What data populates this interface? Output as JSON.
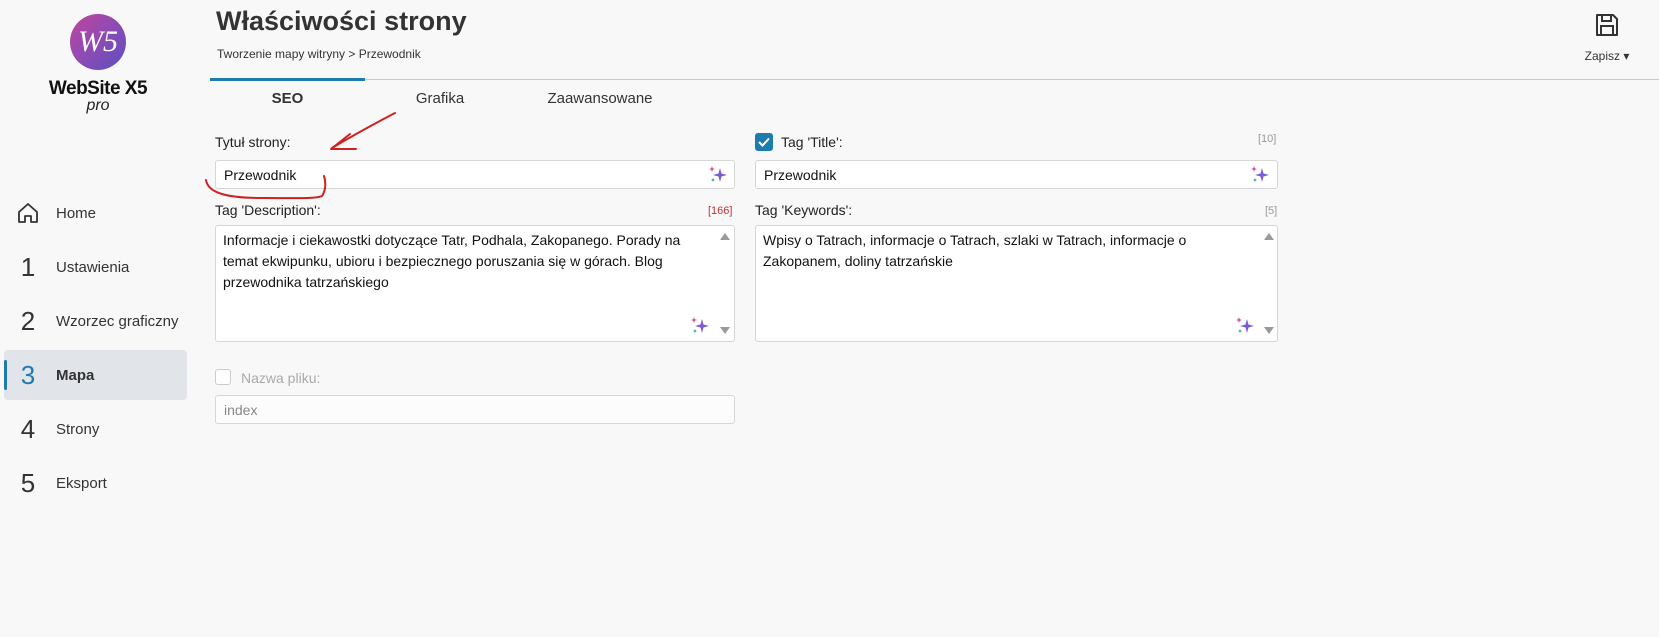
{
  "app": {
    "logo_monogram": "W5",
    "logo_name": "WebSite X5",
    "logo_edition": "pro"
  },
  "header": {
    "title": "Właściwości strony",
    "breadcrumb": "Tworzenie mapy witryny > Przewodnik",
    "save_label": "Zapisz ▾"
  },
  "sidebar": {
    "items": [
      {
        "num": "",
        "icon": "home-icon",
        "label": "Home",
        "active": false
      },
      {
        "num": "1",
        "label": "Ustawienia",
        "active": false
      },
      {
        "num": "2",
        "label": "Wzorzec graficzny",
        "active": false
      },
      {
        "num": "3",
        "label": "Mapa",
        "active": true
      },
      {
        "num": "4",
        "label": "Strony",
        "active": false
      },
      {
        "num": "5",
        "label": "Eksport",
        "active": false
      }
    ]
  },
  "tabs": [
    {
      "label": "SEO",
      "active": true
    },
    {
      "label": "Grafika",
      "active": false
    },
    {
      "label": "Zaawansowane",
      "active": false
    }
  ],
  "form": {
    "page_title_label": "Tytuł strony:",
    "page_title_value": "Przewodnik",
    "title_tag_label": "Tag 'Title':",
    "title_tag_checked": true,
    "title_tag_counter": "[10]",
    "title_tag_value": "Przewodnik",
    "description_label": "Tag 'Description':",
    "description_counter": "[166]",
    "description_value": "Informacje i ciekawostki dotyczące Tatr, Podhala, Zakopanego. Porady na temat ekwipunku, ubioru i bezpiecznego poruszania się w górach. Blog przewodnika tatrzańskiego",
    "keywords_label": "Tag 'Keywords':",
    "keywords_counter": "[5]",
    "keywords_value": "Wpisy o Tatrach, informacje o Tatrach, szlaki w Tatrach, informacje o Zakopanem, doliny tatrzańskie",
    "filename_label": "Nazwa pliku:",
    "filename_checked": false,
    "filename_value": "index"
  },
  "colors": {
    "accent": "#1c7cae",
    "annotation": "#cc2222"
  }
}
